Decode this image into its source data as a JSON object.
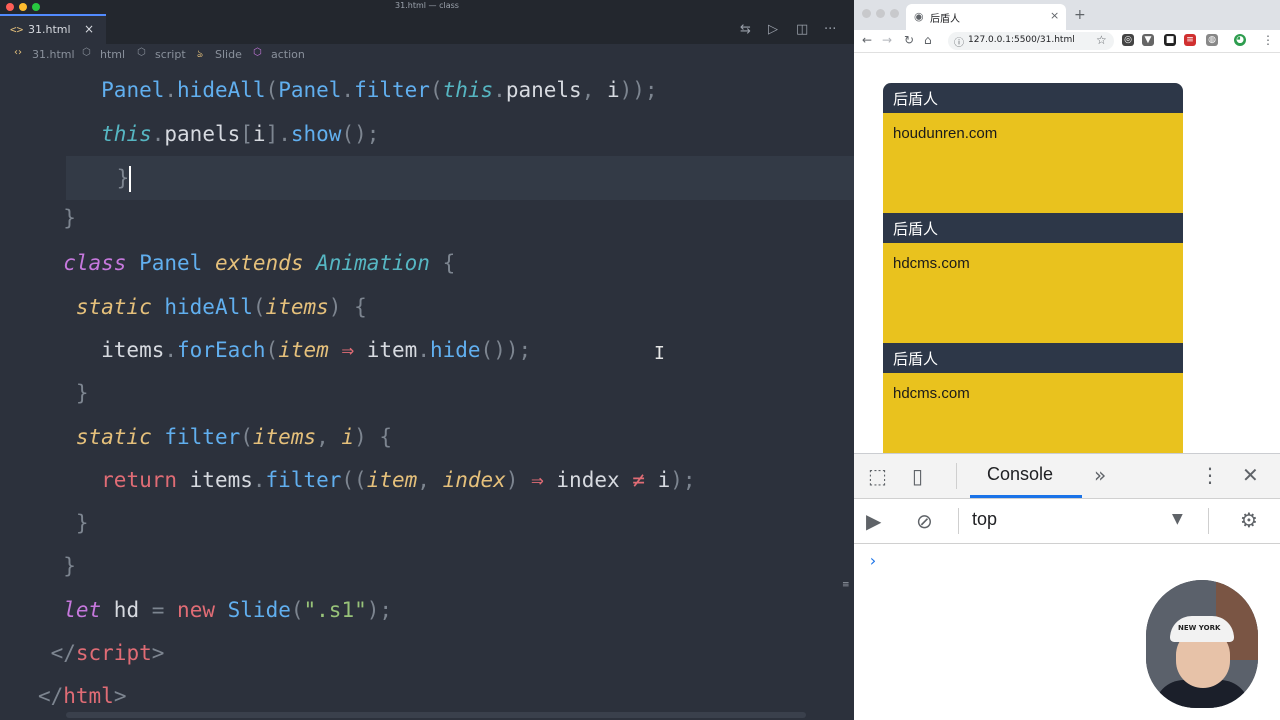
{
  "window": {
    "title": "31.html — class"
  },
  "editor": {
    "tab": {
      "icon": "<>",
      "label": "31.html",
      "close": "×"
    },
    "toolbar_icons": [
      "compare-icon",
      "run-icon",
      "split-editor-icon",
      "more-icon"
    ],
    "breadcrumbs": [
      "31.html",
      "html",
      "script",
      "Slide",
      "action"
    ]
  },
  "browser": {
    "tab_title": "后盾人",
    "url": "127.0.0.1:5500/31.html",
    "panels": [
      {
        "title": "后盾人",
        "content": "houdunren.com"
      },
      {
        "title": "后盾人",
        "content": "hdcms.com"
      },
      {
        "title": "后盾人",
        "content": "hdcms.com"
      }
    ],
    "panel_colors": {
      "header": "#2d3748",
      "body": "#e9c21e"
    }
  },
  "devtools": {
    "active_tab": "Console",
    "more_tabs": "»",
    "context": "top",
    "prompt": "›"
  },
  "webcam": {
    "cap_text": "NEW YORK"
  }
}
